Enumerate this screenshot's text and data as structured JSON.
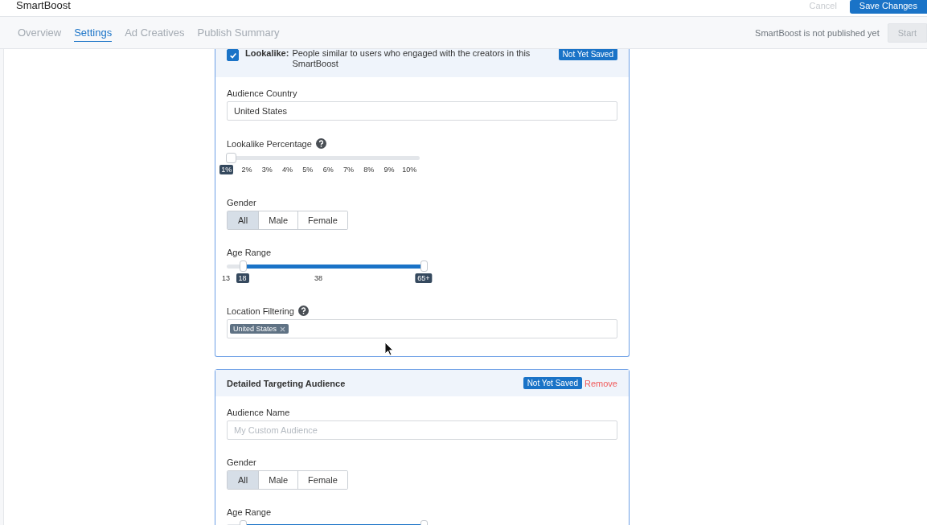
{
  "header": {
    "title": "SmartBoost",
    "cancel": "Cancel",
    "save": "Save Changes"
  },
  "tabs": [
    {
      "label": "Overview",
      "selected": false
    },
    {
      "label": "Settings",
      "selected": true
    },
    {
      "label": "Ad Creatives",
      "selected": false
    },
    {
      "label": "Publish Summary",
      "selected": false
    }
  ],
  "publish_status": "SmartBoost is not published yet",
  "start_button": {
    "label": "Start",
    "disabled": true
  },
  "audiences": [
    {
      "kind": "lookalike",
      "checked": true,
      "title": "Lookalike:",
      "description": "People similar to users who engaged with the creators in this SmartBoost",
      "badge": "Not Yet Saved",
      "fields": [
        {
          "kind": "text",
          "label": "Audience Country",
          "value": "United States"
        },
        {
          "kind": "percent",
          "label": "Lookalike Percentage",
          "help": true,
          "level": 0,
          "ticks": [
            {
              "label": "1%",
              "selected": true
            },
            {
              "label": "2%",
              "selected": false
            },
            {
              "label": "3%",
              "selected": false
            },
            {
              "label": "4%",
              "selected": false
            },
            {
              "label": "5%",
              "selected": false
            },
            {
              "label": "6%",
              "selected": false
            },
            {
              "label": "7%",
              "selected": false
            },
            {
              "label": "8%",
              "selected": false
            },
            {
              "label": "9%",
              "selected": false
            },
            {
              "label": "10%",
              "selected": false
            }
          ]
        },
        {
          "kind": "segmented",
          "label": "Gender",
          "options": [
            {
              "label": "All",
              "selected": true
            },
            {
              "label": "Male",
              "selected": false
            },
            {
              "label": "Female",
              "selected": false
            }
          ]
        },
        {
          "kind": "range",
          "label": "Age Range",
          "min_label": "13",
          "mid_label": "38",
          "thumbs": [
            {
              "level": 0.08,
              "label": "18"
            },
            {
              "level": 1,
              "label": "65+"
            }
          ]
        },
        {
          "kind": "tags",
          "label": "Location Filtering",
          "help": true,
          "tags": [
            "United States"
          ]
        }
      ]
    },
    {
      "kind": "detailed",
      "title": "Detailed Targeting Audience",
      "badge": "Not Yet Saved",
      "remove": "Remove",
      "fields": [
        {
          "kind": "text",
          "label": "Audience Name",
          "placeholder": "My Custom Audience"
        },
        {
          "kind": "segmented",
          "label": "Gender",
          "options": [
            {
              "label": "All",
              "selected": true
            },
            {
              "label": "Male",
              "selected": false
            },
            {
              "label": "Female",
              "selected": false
            }
          ]
        },
        {
          "kind": "range",
          "label": "Age Range",
          "thumbs": [
            {
              "level": 0.08
            },
            {
              "level": 1
            }
          ]
        }
      ]
    }
  ]
}
